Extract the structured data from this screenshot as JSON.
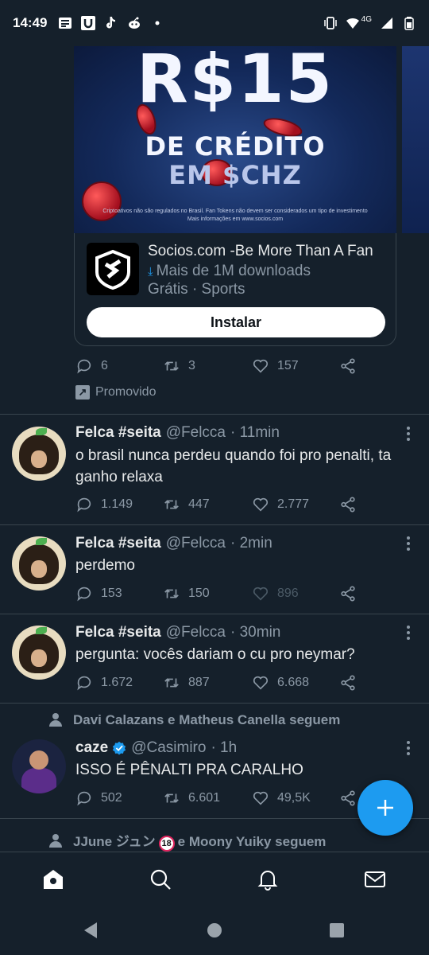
{
  "status_bar": {
    "time": "14:49",
    "notification_icons": [
      "news-icon",
      "u-app-icon",
      "tiktok-icon",
      "reddit-icon",
      "dot-icon"
    ],
    "network": "4G",
    "right_icons": [
      "vibrate-icon",
      "wifi-icon",
      "signal-icon",
      "battery-icon"
    ]
  },
  "ad": {
    "banner_big": "R$15",
    "banner_line1": "DE CRÉDITO",
    "banner_line2": "EM $CHZ",
    "banner_fine": "Criptoativos não são regulados no Brasil. Fan Tokens não devem ser considerados um tipo de investimento Mais informações em www.socios.com",
    "app_name": "Socios.com -Be More Than A Fan",
    "downloads": "Mais de 1M downloads",
    "category": "Grátis · Sports",
    "install_label": "Instalar",
    "replies": "6",
    "retweets": "3",
    "likes": "157",
    "promoted_label": "Promovido"
  },
  "tweets": [
    {
      "name": "Felca #seita",
      "handle": "@Felcca",
      "time": "· 11min",
      "text": "o brasil nunca perdeu quando foi pro penalti, ta ganho relaxa",
      "replies": "1.149",
      "retweets": "447",
      "likes": "2.777"
    },
    {
      "name": "Felca #seita",
      "handle": "@Felcca",
      "time": "· 2min",
      "text": "perdemo",
      "replies": "153",
      "retweets": "150",
      "likes": "896"
    },
    {
      "name": "Felca #seita",
      "handle": "@Felcca",
      "time": "· 30min",
      "text": "pergunta: vocês dariam o cu pro neymar?",
      "replies": "1.672",
      "retweets": "887",
      "likes": "6.668"
    },
    {
      "social_context": "Davi Calazans e Matheus Canella seguem",
      "name": "caze",
      "handle": "@Casimiro",
      "time": "· 1h",
      "text": "ISSO É PÊNALTI PRA CARALHO",
      "replies": "502",
      "retweets": "6.601",
      "likes": "49,5K"
    }
  ],
  "next_context": {
    "name_part": "JJune ジュン",
    "badge": "18",
    "rest": "e Moony Yuiky seguem"
  },
  "colors": {
    "background": "#15202b",
    "accent": "#1d9bf0",
    "muted_text": "#8b98a5",
    "divider": "#38444d"
  }
}
